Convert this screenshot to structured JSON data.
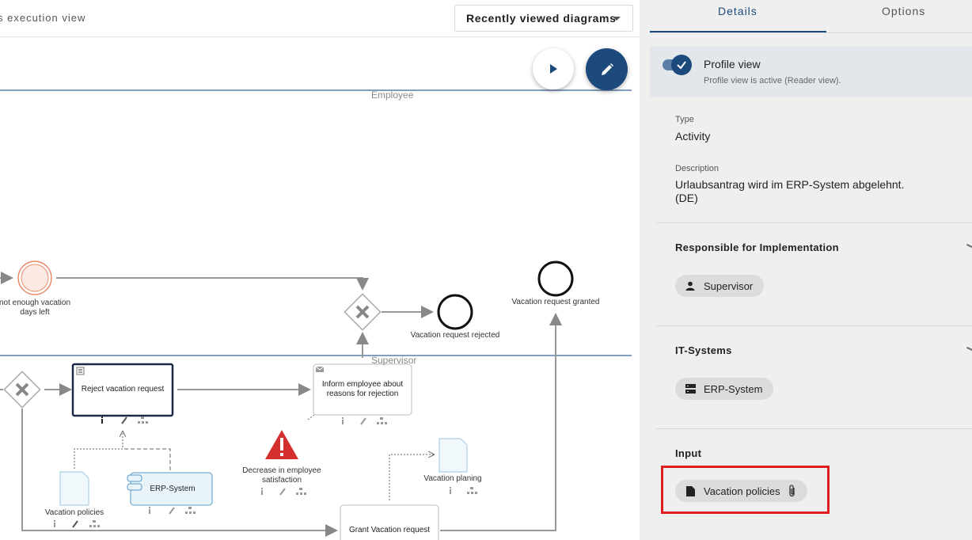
{
  "header": {
    "view_title": "s execution view",
    "diagrams_dropdown": "Recently viewed diagrams"
  },
  "diagram": {
    "lanes": {
      "employee": "Employee",
      "supervisor": "Supervisor"
    },
    "events": {
      "not_enough_days": "not enough vacation days left",
      "request_rejected": "Vacation request rejected",
      "request_granted": "Vacation request granted"
    },
    "tasks": {
      "reject_request": "Reject vacation request",
      "inform_employee": "Inform employee about reasons for rejection",
      "grant_request": "Grant Vacation request",
      "erp_system": "ERP-System"
    },
    "documents": {
      "vacation_policies": "Vacation policies",
      "vacation_planing": "Vacation planing"
    },
    "risk": "Decrease in employee satisfaction"
  },
  "panel": {
    "tabs": {
      "details": "Details",
      "options": "Options"
    },
    "profile": {
      "title": "Profile view",
      "subtitle": "Profile view is active (Reader view)."
    },
    "type": {
      "caption": "Type",
      "value": "Activity"
    },
    "description": {
      "caption": "Description",
      "value_line1": "Urlaubsantrag wird im ERP-System abgelehnt.",
      "value_line2": "(DE)"
    },
    "responsible": {
      "title": "Responsible for Implementation",
      "chip": "Supervisor"
    },
    "it_systems": {
      "title": "IT-Systems",
      "chip": "ERP-System"
    },
    "input": {
      "title": "Input",
      "chip": "Vacation policies"
    }
  },
  "colors": {
    "accent": "#1d4a7d",
    "highlight": "#e02020",
    "start_event": "#e88a6a",
    "risk": "#d32f2f"
  }
}
